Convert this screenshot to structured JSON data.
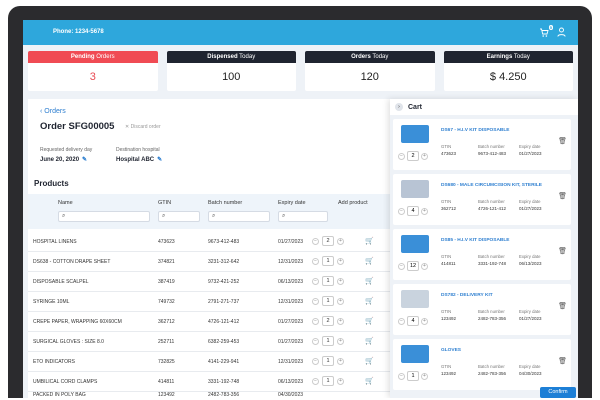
{
  "topbar": {
    "phone_label": "Phone:",
    "phone_value": "1234-5678",
    "cart_count": "5"
  },
  "stats": [
    {
      "label_bold": "Pending",
      "label_rest": " Orders",
      "value": "3"
    },
    {
      "label_bold": "Dispensed",
      "label_rest": " Today",
      "value": "100"
    },
    {
      "label_bold": "Orders",
      "label_rest": " Today",
      "value": "120"
    },
    {
      "label_bold": "Earnings",
      "label_rest": " Today",
      "value": "$ 4.250"
    }
  ],
  "order": {
    "back_label": "Orders",
    "title": "Order SFG00005",
    "discard_label": "Discard order",
    "delivery_label": "Requested delivery day",
    "delivery_value": "June 20, 2020",
    "hospital_label": "Destination hospital",
    "hospital_value": "Hospital ABC"
  },
  "products": {
    "heading": "Products",
    "columns": [
      "Name",
      "GTIN",
      "Batch number",
      "Expiry date",
      "Add product"
    ],
    "rows": [
      {
        "name": "Hospital linens",
        "gtin": "473623",
        "batch": "9673-412-483",
        "expiry": "01/27/2023",
        "qty": "2"
      },
      {
        "name": "DS638 - Cotton drape sheet",
        "gtin": "374821",
        "batch": "3231-312-642",
        "expiry": "12/31/2023",
        "qty": "1"
      },
      {
        "name": "Disposable scalpel",
        "gtin": "387419",
        "batch": "9732-421-252",
        "expiry": "06/13/2023",
        "qty": "1"
      },
      {
        "name": "Syringe 10ml",
        "gtin": "749732",
        "batch": "2791-271-737",
        "expiry": "12/31/2023",
        "qty": "1"
      },
      {
        "name": "Crepe paper, wrapping 60x60cm",
        "gtin": "362712",
        "batch": "4726-121-412",
        "expiry": "01/27/2023",
        "qty": "2"
      },
      {
        "name": "Surgical gloves : size 8.0",
        "gtin": "252711",
        "batch": "6382-259-453",
        "expiry": "01/27/2023",
        "qty": "1"
      },
      {
        "name": "ETO indicators",
        "gtin": "732825",
        "batch": "4141-229-941",
        "expiry": "12/31/2023",
        "qty": "1"
      },
      {
        "name": "Umbilical cord clamps",
        "gtin": "414811",
        "batch": "3331-192-748",
        "expiry": "06/13/2023",
        "qty": "1"
      },
      {
        "name": "Packed in poly bag",
        "gtin": "123492",
        "batch": "2482-783-356",
        "expiry": "04/30/2023",
        "qty": "2"
      }
    ]
  },
  "cart": {
    "title": "Cart",
    "gtin_label": "GTIN",
    "batch_label": "Batch number",
    "expiry_label": "Expiry date",
    "confirm_label": "Confirm",
    "items": [
      {
        "name": "DS67 - H.I.V KIT DISPOSABLE",
        "gtin": "473623",
        "batch": "9673-412-483",
        "expiry": "01/27/2023",
        "qty": "2",
        "color": "#3a8fd8"
      },
      {
        "name": "DS680 - MALE CIRCUMCISION KIT, STERILE",
        "gtin": "362712",
        "batch": "4726-121-412",
        "expiry": "01/27/2023",
        "qty": "4",
        "color": "#b8c4d4"
      },
      {
        "name": "DS85 - H.I.V KIT DISPOSABLE",
        "gtin": "414811",
        "batch": "3331-192-748",
        "expiry": "06/13/2023",
        "qty": "12",
        "color": "#3a8fd8"
      },
      {
        "name": "DS782 - DELIVERY KIT",
        "gtin": "123492",
        "batch": "2482-783-356",
        "expiry": "01/27/2023",
        "qty": "4",
        "color": "#c9d3de"
      },
      {
        "name": "GLOVES",
        "gtin": "123492",
        "batch": "2482-783-356",
        "expiry": "04/30/2023",
        "qty": "1",
        "color": "#3a8fd8"
      }
    ]
  }
}
